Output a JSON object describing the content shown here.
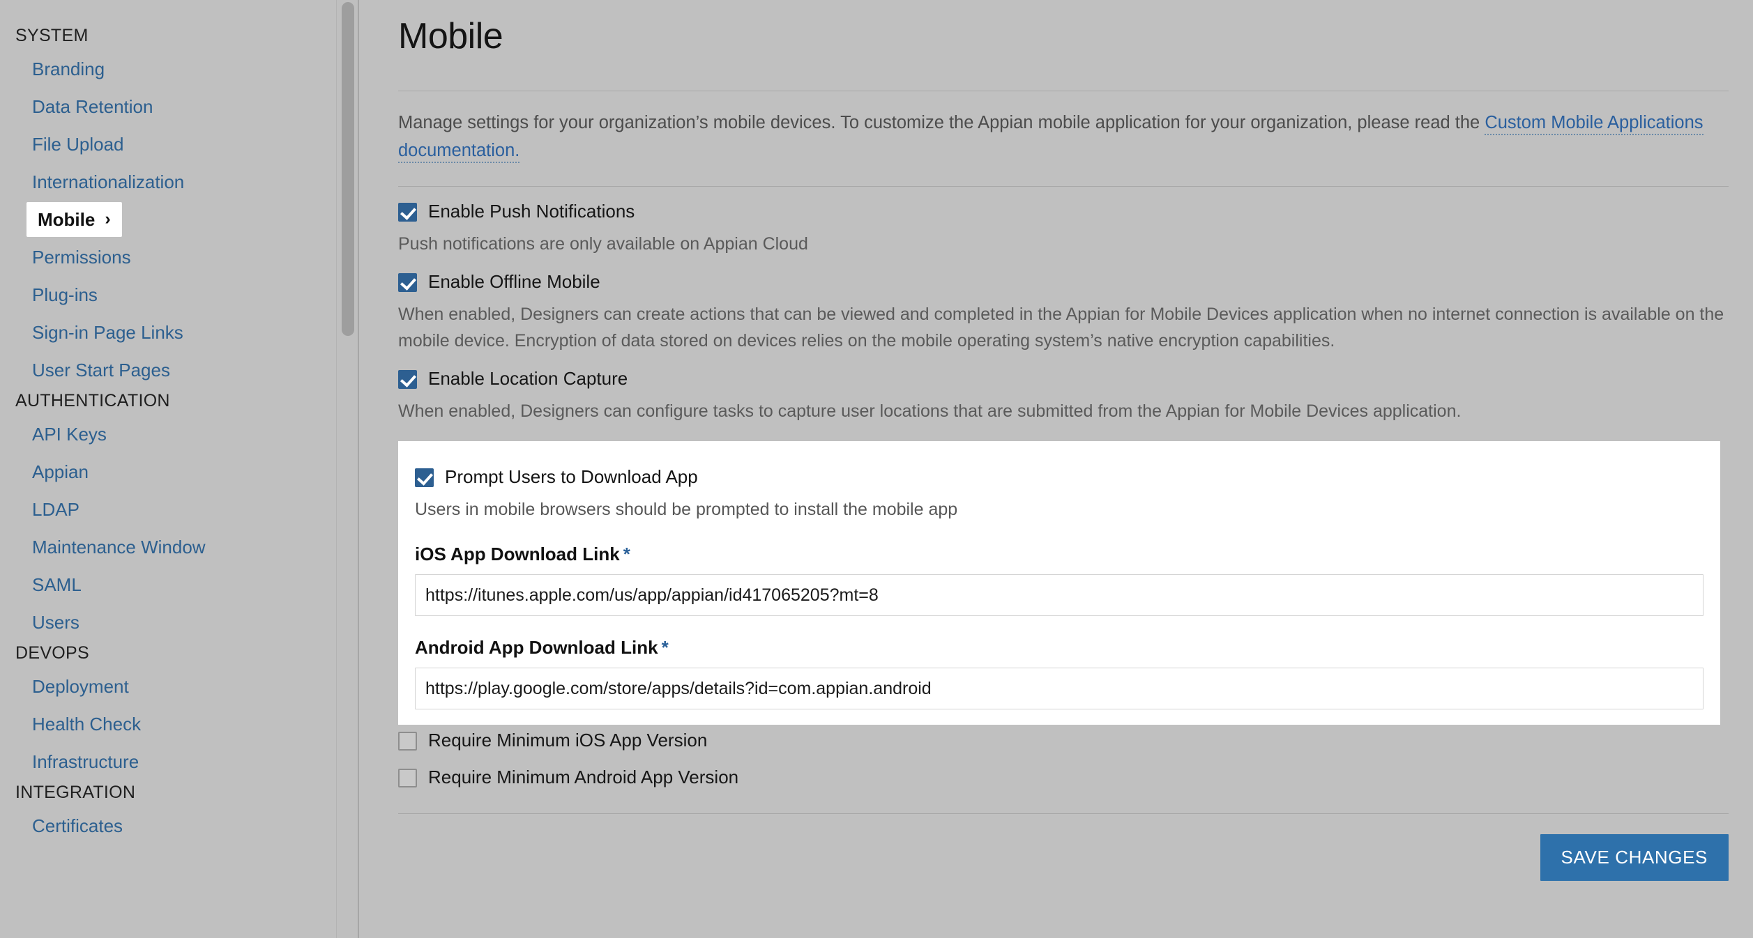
{
  "sidebar": {
    "groups": [
      {
        "title": "SYSTEM",
        "items": [
          {
            "label": "Branding",
            "active": false
          },
          {
            "label": "Data Retention",
            "active": false
          },
          {
            "label": "File Upload",
            "active": false
          },
          {
            "label": "Internationalization",
            "active": false
          },
          {
            "label": "Mobile",
            "active": true,
            "chevron": "›"
          },
          {
            "label": "Permissions",
            "active": false
          },
          {
            "label": "Plug-ins",
            "active": false
          },
          {
            "label": "Sign-in Page Links",
            "active": false
          },
          {
            "label": "User Start Pages",
            "active": false
          }
        ]
      },
      {
        "title": "AUTHENTICATION",
        "items": [
          {
            "label": "API Keys",
            "active": false
          },
          {
            "label": "Appian",
            "active": false
          },
          {
            "label": "LDAP",
            "active": false
          },
          {
            "label": "Maintenance Window",
            "active": false
          },
          {
            "label": "SAML",
            "active": false
          },
          {
            "label": "Users",
            "active": false
          }
        ]
      },
      {
        "title": "DEVOPS",
        "items": [
          {
            "label": "Deployment",
            "active": false
          },
          {
            "label": "Health Check",
            "active": false
          },
          {
            "label": "Infrastructure",
            "active": false
          }
        ]
      },
      {
        "title": "INTEGRATION",
        "items": [
          {
            "label": "Certificates",
            "active": false
          }
        ]
      }
    ],
    "accent_link_color": "#2c5f8f"
  },
  "main": {
    "page_title": "Mobile",
    "intro_text": "Manage settings for your organization’s mobile devices. To customize the Appian mobile application for your organization, please read the",
    "intro_link": "Custom Mobile Applications documentation.",
    "settings": [
      {
        "label": "Enable Push Notifications",
        "checked": true,
        "help": "Push notifications are only available on Appian Cloud"
      },
      {
        "label": "Enable Offline Mobile",
        "checked": true,
        "help": "When enabled, Designers can create actions that can be viewed and completed in the Appian for Mobile Devices application when no internet connection is available on the mobile device. Encryption of data stored on devices relies on the mobile operating system’s native encryption capabilities."
      },
      {
        "label": "Enable Location Capture",
        "checked": true,
        "help": "When enabled, Designers can configure tasks to capture user locations that are submitted from the Appian for Mobile Devices application."
      }
    ],
    "panel": {
      "label": "Prompt Users to Download App",
      "checked": true,
      "help": "Users in mobile browsers should be prompted to install the mobile app",
      "fields": [
        {
          "label": "iOS App Download Link",
          "required_marker": "*",
          "value": "https://itunes.apple.com/us/app/appian/id417065205?mt=8",
          "placeholder": ""
        },
        {
          "label": "Android App Download Link",
          "required_marker": "*",
          "value": "https://play.google.com/store/apps/details?id=com.appian.android",
          "placeholder": ""
        }
      ]
    },
    "version_settings": [
      {
        "label": "Require Minimum iOS App Version",
        "checked": false
      },
      {
        "label": "Require Minimum Android App Version",
        "checked": false
      }
    ],
    "save_button": "SAVE CHANGES",
    "colors": {
      "accent_blue": "#2e71ab",
      "checkbox_blue": "#2d5f91",
      "link_blue": "#2a5f9e",
      "page_bg": "#c0c0c0",
      "panel_bg": "#ffffff"
    }
  }
}
